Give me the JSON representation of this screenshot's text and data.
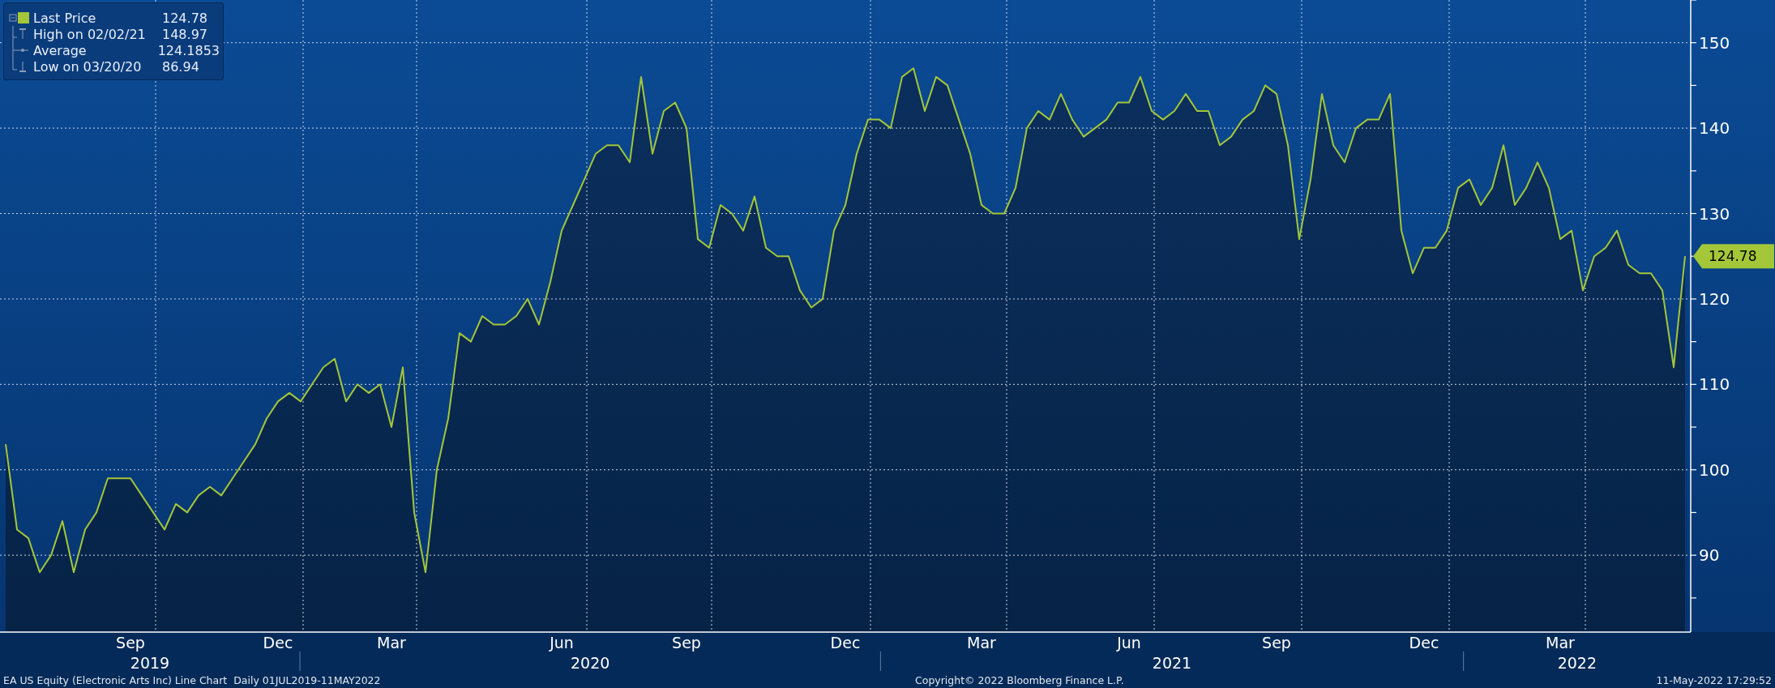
{
  "legend": [
    {
      "kind": "series",
      "value": "124.78"
    },
    {
      "kind": "high",
      "label": "High on 02/02/21",
      "value": "148.97"
    },
    {
      "kind": "average",
      "label": "Average",
      "value": "124.1853"
    },
    {
      "kind": "low",
      "label": "Low on 03/20/20",
      "value": "86.94"
    }
  ],
  "chart_data": {
    "type": "area",
    "grid": true,
    "ylim": [
      81,
      155
    ],
    "yticks": [
      90,
      100,
      110,
      120,
      130,
      140,
      150
    ],
    "categories": [
      null,
      null,
      null,
      null,
      null,
      null,
      null,
      null,
      null,
      null,
      null,
      "Sep",
      null,
      null,
      null,
      null,
      null,
      null,
      null,
      null,
      null,
      null,
      null,
      null,
      "Dec",
      null,
      null,
      null,
      null,
      null,
      null,
      null,
      null,
      null,
      "Mar",
      null,
      null,
      null,
      null,
      null,
      null,
      null,
      null,
      null,
      null,
      null,
      null,
      null,
      null,
      "Jun",
      null,
      null,
      null,
      null,
      null,
      null,
      null,
      null,
      null,
      null,
      "Sep",
      null,
      null,
      null,
      null,
      null,
      null,
      null,
      null,
      null,
      null,
      null,
      null,
      null,
      "Dec",
      null,
      null,
      null,
      null,
      null,
      null,
      null,
      null,
      null,
      null,
      null,
      "Mar",
      null,
      null,
      null,
      null,
      null,
      null,
      null,
      null,
      null,
      null,
      null,
      null,
      "Jun",
      null,
      null,
      null,
      null,
      null,
      null,
      null,
      null,
      null,
      null,
      null,
      null,
      "Sep",
      null,
      null,
      null,
      null,
      null,
      null,
      null,
      null,
      null,
      null,
      null,
      null,
      "Dec",
      null,
      null,
      null,
      null,
      null,
      null,
      null,
      null,
      null,
      null,
      null,
      "Mar",
      null,
      null,
      null,
      null,
      null,
      null,
      null,
      null,
      null,
      null,
      null
    ],
    "series": [
      {
        "name": "Last Price",
        "color": "#a4c639",
        "values": [
          103,
          93,
          92,
          88,
          90,
          94,
          88,
          93,
          95,
          99,
          99,
          99,
          97,
          95,
          93,
          96,
          95,
          97,
          98,
          97,
          99,
          101,
          103,
          106,
          108,
          109,
          108,
          110,
          112,
          113,
          108,
          110,
          109,
          110,
          105,
          112,
          95,
          88,
          100,
          106,
          116,
          115,
          118,
          117,
          117,
          118,
          120,
          117,
          122,
          128,
          131,
          134,
          137,
          138,
          138,
          136,
          146,
          137,
          142,
          143,
          140,
          127,
          126,
          131,
          130,
          128,
          132,
          126,
          125,
          125,
          121,
          119,
          120,
          128,
          131,
          137,
          141,
          141,
          140,
          146,
          147,
          142,
          146,
          145,
          141,
          137,
          131,
          130,
          130,
          133,
          140,
          142,
          141,
          144,
          141,
          139,
          140,
          141,
          143,
          143,
          146,
          142,
          141,
          142,
          144,
          142,
          142,
          138,
          139,
          141,
          142,
          145,
          144,
          138,
          127,
          134,
          144,
          138,
          136,
          140,
          141,
          141,
          144,
          128,
          123,
          126,
          126,
          128,
          133,
          134,
          131,
          133,
          138,
          131,
          133,
          136,
          133,
          127,
          128,
          121,
          125,
          126,
          128,
          124,
          123,
          123,
          121,
          112,
          125
        ]
      }
    ],
    "annotations": [
      {
        "text": "124.78"
      }
    ]
  },
  "year_labels": [
    {
      "label": "2019"
    },
    {
      "label": "2020"
    },
    {
      "label": "2021"
    },
    {
      "label": "2022"
    }
  ],
  "footer": {
    "description": "EA US Equity (Electronic Arts Inc) Line Chart  Daily 01JUL2019-11MAY2022",
    "copyright": "Copyright© 2022 Bloomberg Finance L.P.",
    "timestamp": "11-May-2022 17:29:52"
  }
}
